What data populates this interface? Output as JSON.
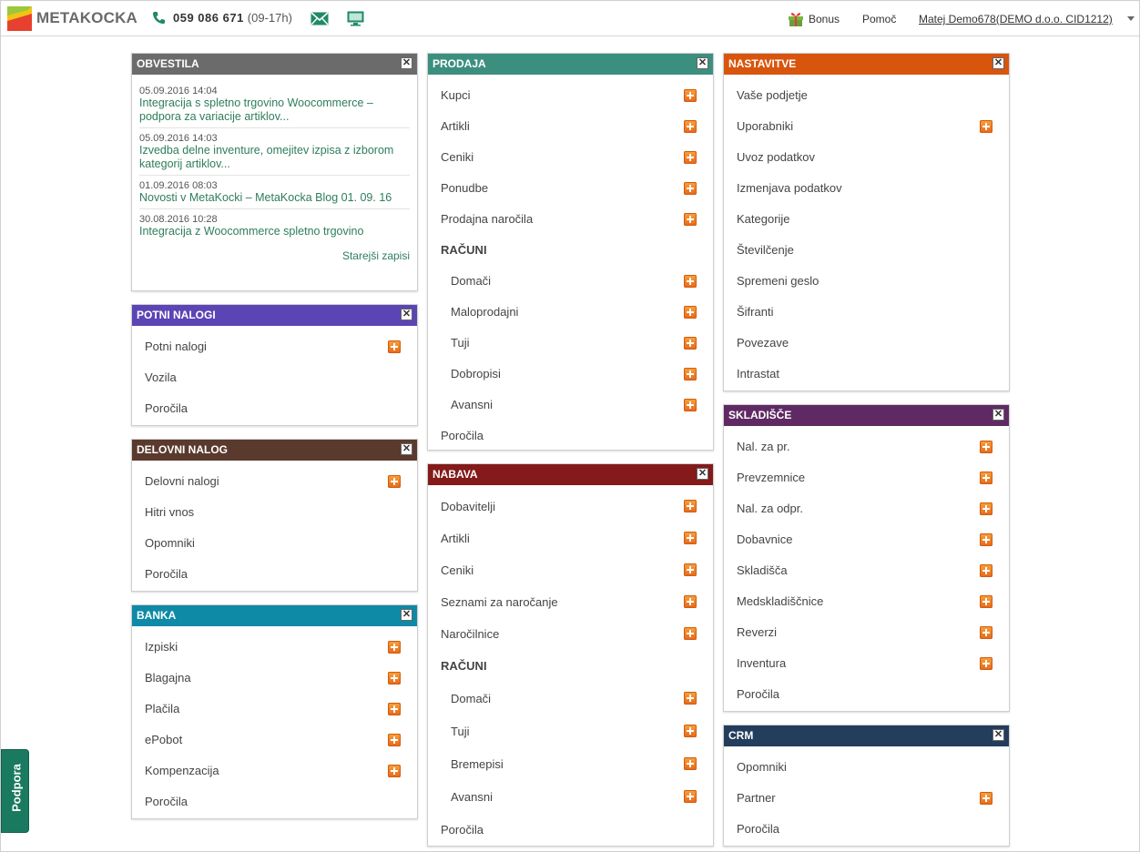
{
  "brand": {
    "name": "METAKOCKA"
  },
  "header": {
    "phone": "059 086 671",
    "phone_hours": "(09-17h)",
    "bonus": "Bonus",
    "help": "Pomoč",
    "user": "Matej Demo678(DEMO d.o.o. CID1212)"
  },
  "colors": {
    "obvestila": "#6b6b6b",
    "prodaja": "#3c8f7e",
    "nastavitve": "#d8550d",
    "potni": "#5b45b5",
    "delovni": "#5a3a2d",
    "banka": "#0e8aa6",
    "nabava": "#841a1a",
    "skladisce": "#5f2a63",
    "crm": "#233d5c"
  },
  "obvestila": {
    "title": "OBVESTILA",
    "items": [
      {
        "date": "05.09.2016 14:04",
        "title": "Integracija s spletno trgovino Woocommerce – podpora za variacije artiklov..."
      },
      {
        "date": "05.09.2016 14:03",
        "title": "Izvedba delne inventure, omejitev izpisa z izborom kategorij artiklov..."
      },
      {
        "date": "01.09.2016 08:03",
        "title": "Novosti v MetaKocki – MetaKocka Blog 01. 09. 16"
      },
      {
        "date": "30.08.2016 10:28",
        "title": "Integracija z Woocommerce spletno trgovino"
      }
    ],
    "older": "Starejši zapisi"
  },
  "potni": {
    "title": "POTNI NALOGI",
    "items": [
      "Potni nalogi",
      "Vozila",
      "Poročila"
    ]
  },
  "delovni": {
    "title": "DELOVNI NALOG",
    "items": [
      "Delovni nalogi",
      "Hitri vnos",
      "Opomniki",
      "Poročila"
    ]
  },
  "banka": {
    "title": "BANKA",
    "items": [
      "Izpiski",
      "Blagajna",
      "Plačila",
      "ePobot",
      "Kompenzacija",
      "Poročila"
    ]
  },
  "prodaja": {
    "title": "PRODAJA",
    "items": [
      "Kupci",
      "Artikli",
      "Ceniki",
      "Ponudbe",
      "Prodajna naročila"
    ],
    "section": "RAČUNI",
    "sub": [
      "Domači",
      "Maloprodajni",
      "Tuji",
      "Dobropisi",
      "Avansni"
    ],
    "reports": "Poročila"
  },
  "nabava": {
    "title": "NABAVA",
    "items": [
      "Dobavitelji",
      "Artikli",
      "Ceniki",
      "Seznami za naročanje",
      "Naročilnice"
    ],
    "section": "RAČUNI",
    "sub": [
      "Domači",
      "Tuji",
      "Bremepisi",
      "Avansni"
    ],
    "reports": "Poročila"
  },
  "nastavitve": {
    "title": "NASTAVITVE",
    "items": [
      "Vaše podjetje",
      "Uporabniki",
      "Uvoz podatkov",
      "Izmenjava podatkov",
      "Kategorije",
      "Številčenje",
      "Spremeni geslo",
      "Šifranti",
      "Povezave",
      "Intrastat"
    ]
  },
  "skladisce": {
    "title": "SKLADIŠČE",
    "items": [
      "Nal. za pr.",
      "Prevzemnice",
      "Nal. za odpr.",
      "Dobavnice",
      "Skladišča",
      "Medskladiščnice",
      "Reverzi",
      "Inventura",
      "Poročila"
    ]
  },
  "crm": {
    "title": "CRM",
    "items": [
      "Opomniki",
      "Partner",
      "Poročila"
    ]
  },
  "support": {
    "label": "Podpora"
  }
}
